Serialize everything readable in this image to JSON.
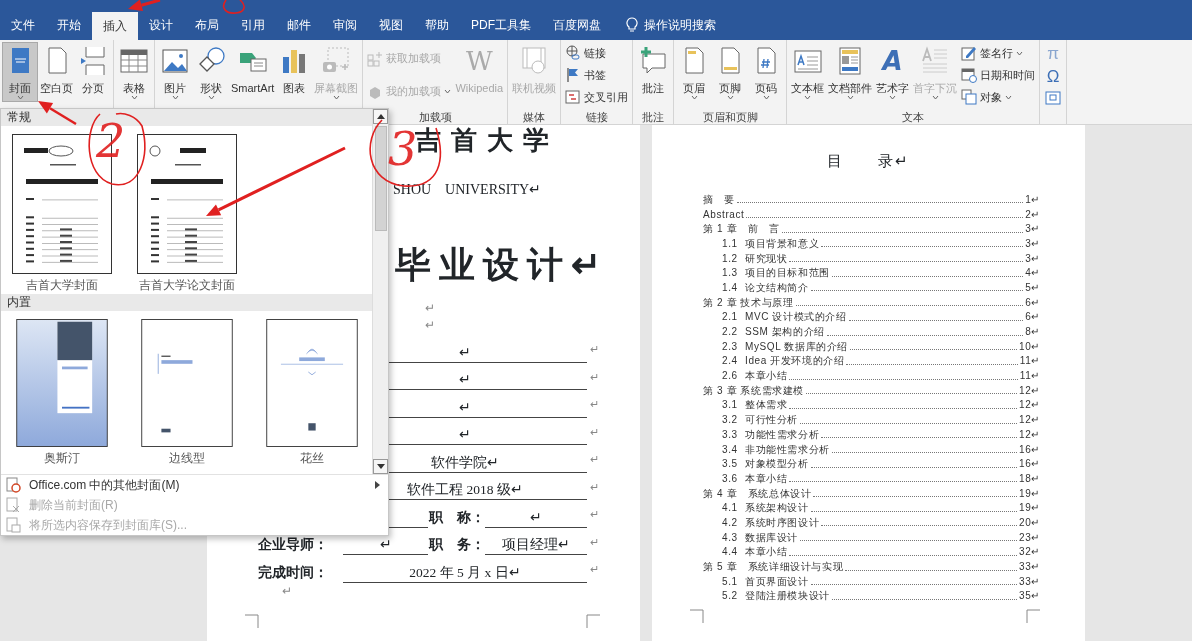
{
  "tabs": [
    {
      "label": "文件",
      "selected": false
    },
    {
      "label": "开始",
      "selected": false
    },
    {
      "label": "插入",
      "selected": true
    },
    {
      "label": "设计",
      "selected": false
    },
    {
      "label": "布局",
      "selected": false
    },
    {
      "label": "引用",
      "selected": false
    },
    {
      "label": "邮件",
      "selected": false
    },
    {
      "label": "审阅",
      "selected": false
    },
    {
      "label": "视图",
      "selected": false
    },
    {
      "label": "帮助",
      "selected": false
    },
    {
      "label": "PDF工具集",
      "selected": false
    },
    {
      "label": "百度网盘",
      "selected": false
    }
  ],
  "search": {
    "label": "操作说明搜索"
  },
  "ribbon": {
    "groups": [
      {
        "items": [
          {
            "label": "封面",
            "kind": "large",
            "disabled": false,
            "caret": true,
            "expanded": true
          },
          {
            "label": "空白页",
            "kind": "large",
            "disabled": false
          },
          {
            "label": "分页",
            "kind": "large",
            "disabled": false
          }
        ]
      },
      {
        "items": [
          {
            "label": "表格",
            "kind": "large",
            "disabled": false,
            "caret": true,
            "expanded": false
          }
        ]
      },
      {
        "items": [
          {
            "label": "图片",
            "kind": "large",
            "disabled": false,
            "caret": true,
            "expanded": false
          },
          {
            "label": "形状",
            "kind": "large",
            "disabled": false,
            "caret": true,
            "expanded": false
          },
          {
            "label": "SmartArt",
            "kind": "large",
            "disabled": false
          },
          {
            "label": "图表",
            "kind": "large",
            "disabled": false
          },
          {
            "label": "屏幕截图",
            "kind": "large",
            "disabled": true,
            "caret": true,
            "expanded": false
          }
        ]
      },
      {
        "label": "加载项",
        "items": [
          {
            "label": "获取加载项",
            "kind": "small",
            "disabled": true
          },
          {
            "label": "我的加载项",
            "kind": "small",
            "disabled": true,
            "caret": true
          },
          {
            "label": "Wikipedia",
            "kind": "large",
            "disabled": true,
            "glyph": "W"
          }
        ]
      },
      {
        "label": "媒体",
        "items": [
          {
            "label": "联机视频",
            "kind": "large",
            "disabled": true
          }
        ]
      },
      {
        "label": "链接",
        "items": [
          {
            "label": "链接",
            "kind": "small",
            "disabled": false
          },
          {
            "label": "书签",
            "kind": "small",
            "disabled": false
          },
          {
            "label": "交叉引用",
            "kind": "small",
            "disabled": false
          }
        ]
      },
      {
        "label": "批注",
        "items": [
          {
            "label": "批注",
            "kind": "large",
            "disabled": false
          }
        ]
      },
      {
        "label": "页眉和页脚",
        "items": [
          {
            "label": "页眉",
            "kind": "large",
            "disabled": false,
            "caret": true,
            "expanded": false
          },
          {
            "label": "页脚",
            "kind": "large",
            "disabled": false,
            "caret": true,
            "expanded": false
          },
          {
            "label": "页码",
            "kind": "large",
            "disabled": false,
            "caret": true,
            "expanded": false
          }
        ]
      },
      {
        "label": "文本",
        "items": [
          {
            "label": "文本框",
            "kind": "large",
            "disabled": false,
            "caret": true,
            "expanded": false
          },
          {
            "label": "文档部件",
            "kind": "large",
            "disabled": false,
            "caret": true,
            "expanded": false
          },
          {
            "label": "艺术字",
            "kind": "large",
            "disabled": false,
            "caret": true,
            "expanded": false,
            "glyph": "A"
          },
          {
            "label": "首字下沉",
            "kind": "large",
            "disabled": true,
            "caret": true,
            "expanded": false
          },
          {
            "label": "签名行",
            "kind": "small",
            "disabled": false,
            "caret": true
          },
          {
            "label": "日期和时间",
            "kind": "small",
            "disabled": false
          },
          {
            "label": "对象",
            "kind": "small",
            "disabled": false,
            "caret": true
          }
        ]
      },
      {
        "items": [
          {
            "kind": "glyph",
            "glyph": "π",
            "disabled": false
          },
          {
            "kind": "glyph",
            "glyph": "Ω",
            "disabled": false
          },
          {
            "kind": "icon",
            "disabled": false
          }
        ]
      }
    ]
  },
  "cover_menu": {
    "sections": [
      {
        "title": "常规",
        "items": [
          {
            "label": "吉首大学封面"
          },
          {
            "label": "吉首大学论文封面"
          }
        ]
      },
      {
        "title": "内置",
        "items": [
          {
            "label": "奥斯汀"
          },
          {
            "label": "边线型"
          },
          {
            "label": "花丝"
          }
        ]
      }
    ],
    "commands": [
      {
        "label": "Office.com 中的其他封面(M)",
        "disabled": false,
        "submenu": true
      },
      {
        "label": "删除当前封面(R)",
        "disabled": true,
        "submenu": false
      },
      {
        "label": "将所选内容保存到封面库(S)...",
        "disabled": true,
        "submenu": false
      }
    ]
  },
  "page_1": {
    "logo": "吉首大学",
    "university": "SHOU　UNIVERSITY↵",
    "heading": "毕业设计↵",
    "blank_marks": [
      "↵",
      "↵"
    ],
    "form": [
      {
        "value": "↵",
        "end": "↵"
      },
      {
        "value": "↵",
        "end": "↵"
      },
      {
        "value": "↵",
        "end": "↵"
      },
      {
        "value": "↵",
        "end": "↵"
      },
      {
        "value": "软件学院↵",
        "end": "↵"
      },
      {
        "value": "软件工程 2018 级↵",
        "end": "↵"
      },
      {
        "field_label": "职　称：",
        "field_value": "↵",
        "end": "↵"
      },
      {
        "label": "企业导师：",
        "value": "↵",
        "field_label": "职　务：",
        "field_value": "项目经理↵",
        "end": "↵"
      },
      {
        "label": "完成时间：",
        "value": "2022 年 5 月 x 日↵",
        "end": "↵"
      }
    ],
    "trailing_mark": "↵"
  },
  "page_2": {
    "title": "目　　录↵",
    "entries": [
      {
        "title": "摘　要",
        "page": "1↵"
      },
      {
        "title": "Abstract",
        "page": "2↵"
      },
      {
        "title": "第 1 章　前　言",
        "page": "3↵",
        "children": [
          {
            "number": "1.1",
            "title": "项目背景和意义",
            "page": "3↵"
          },
          {
            "number": "1.2",
            "title": "研究现状",
            "page": "3↵"
          },
          {
            "number": "1.3",
            "title": "项目的目标和范围",
            "page": "4↵"
          },
          {
            "number": "1.4",
            "title": "论文结构简介",
            "page": "5↵"
          }
        ]
      },
      {
        "title": "第 2 章 技术与原理",
        "page": "6↵",
        "children": [
          {
            "number": "2.1",
            "title": "MVC 设计模式的介绍",
            "page": "6↵"
          },
          {
            "number": "2.2",
            "title": "SSM 架构的介绍",
            "page": "8↵"
          },
          {
            "number": "2.3",
            "title": "MySQL 数据库的介绍",
            "page": "10↵"
          },
          {
            "number": "2.4",
            "title": "Idea 开发环境的介绍",
            "page": "11↵"
          },
          {
            "number": "2.6",
            "title": "本章小结",
            "page": "11↵"
          }
        ]
      },
      {
        "title": "第 3 章 系统需求建模",
        "page": "12↵",
        "children": [
          {
            "number": "3.1",
            "title": "整体需求",
            "page": "12↵"
          },
          {
            "number": "3.2",
            "title": "可行性分析",
            "page": "12↵"
          },
          {
            "number": "3.3",
            "title": "功能性需求分析",
            "page": "12↵"
          },
          {
            "number": "3.4",
            "title": "非功能性需求分析",
            "page": "16↵"
          },
          {
            "number": "3.5",
            "title": "对象模型分析",
            "page": "16↵"
          },
          {
            "number": "3.6",
            "title": "本章小结",
            "page": "18↵"
          }
        ]
      },
      {
        "title": "第 4 章　系统总体设计",
        "page": "19↵",
        "children": [
          {
            "number": "4.1",
            "title": "系统架构设计",
            "page": "19↵"
          },
          {
            "number": "4.2",
            "title": "系统时序图设计",
            "page": "20↵"
          },
          {
            "number": "4.3",
            "title": "数据库设计",
            "page": "23↵"
          },
          {
            "number": "4.4",
            "title": "本章小结",
            "page": "32↵"
          }
        ]
      },
      {
        "title": "第 5 章　系统详细设计与实现",
        "page": "33↵",
        "children": [
          {
            "number": "5.1",
            "title": "首页界面设计",
            "page": "33↵"
          },
          {
            "number": "5.2",
            "title": "登陆注册模块设计",
            "page": "35↵"
          }
        ]
      }
    ]
  },
  "annotations": {
    "numbers": [
      "2",
      "3"
    ]
  }
}
